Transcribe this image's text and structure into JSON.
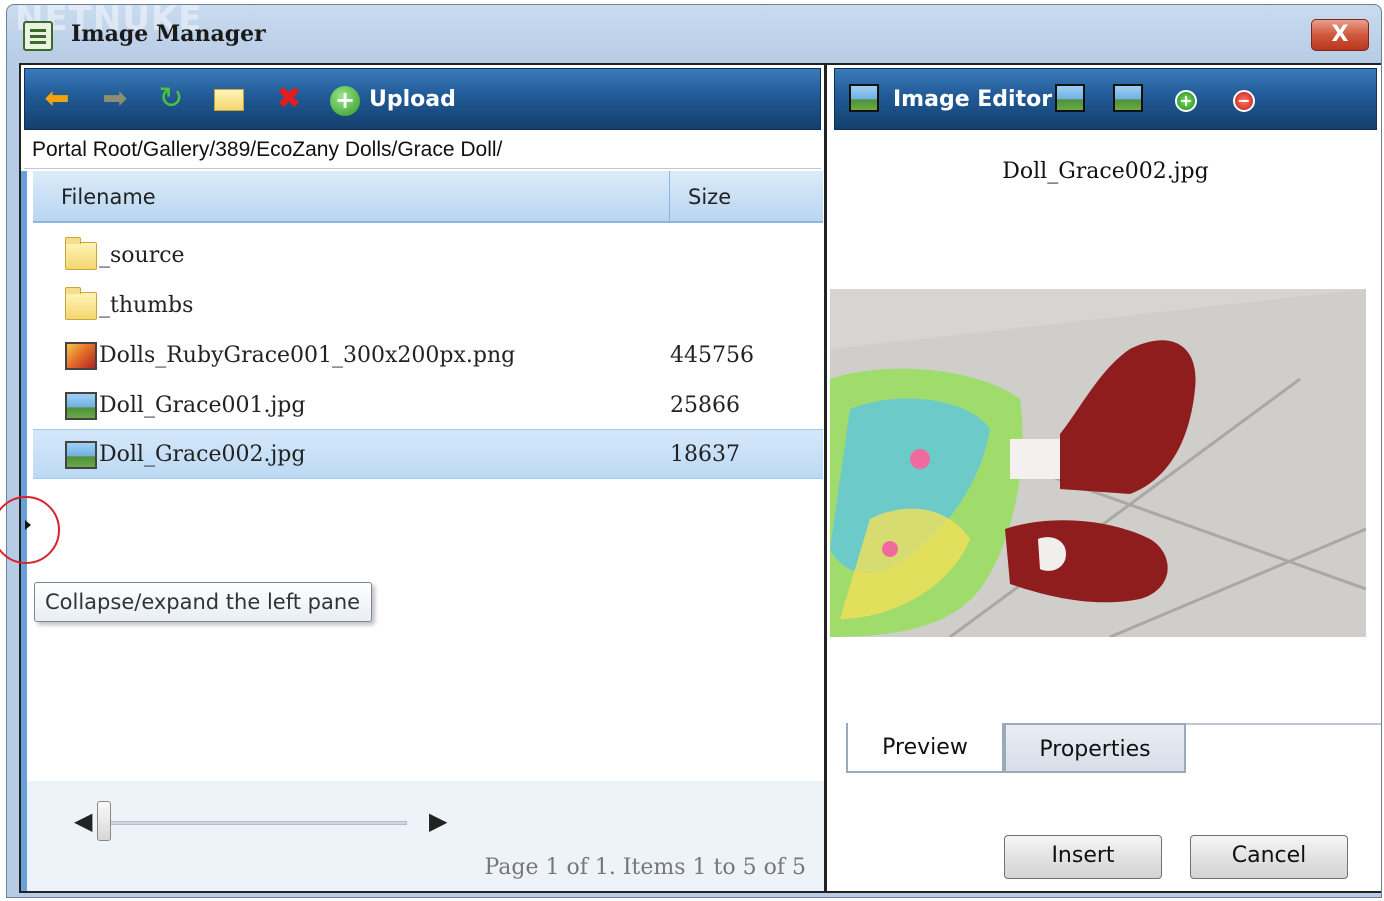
{
  "window": {
    "title": "Image Manager",
    "watermark": "NETNUKE",
    "close_glyph": "X"
  },
  "toolbar": {
    "upload_label": "Upload"
  },
  "path": "Portal Root/Gallery/389/EcoZany Dolls/Grace Doll/",
  "grid": {
    "columns": [
      "Filename",
      "Size"
    ],
    "rows": [
      {
        "name": "_source",
        "size": "",
        "icon": "folder-icon"
      },
      {
        "name": "_thumbs",
        "size": "",
        "icon": "folder-icon"
      },
      {
        "name": "Dolls_RubyGrace001_300x200px.png",
        "size": "445756",
        "icon": "png-file-icon"
      },
      {
        "name": "Doll_Grace001.jpg",
        "size": "25866",
        "icon": "jpg-file-icon"
      },
      {
        "name": "Doll_Grace002.jpg",
        "size": "18637",
        "icon": "jpg-file-icon",
        "selected": true
      }
    ]
  },
  "pager": {
    "text": "Page 1 of 1. Items 1 to 5 of 5"
  },
  "editor": {
    "title": "Image Editor",
    "filename": "Doll_Grace002.jpg",
    "tabs": [
      "Preview",
      "Properties"
    ],
    "insert_label": "Insert",
    "cancel_label": "Cancel"
  },
  "tooltip": "Collapse/expand the left pane",
  "colors": {
    "toolbar_blue": "#215a95",
    "selection": "#bcd9f4",
    "highlight_red": "#d9232b"
  }
}
